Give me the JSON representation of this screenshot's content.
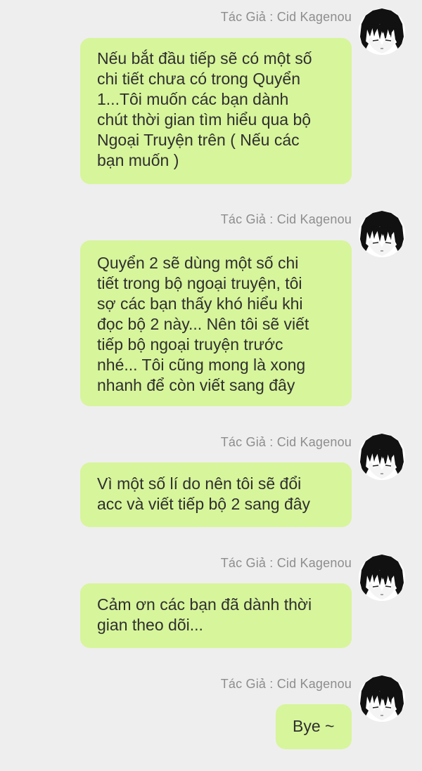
{
  "messages": [
    {
      "author": "Tác Giả : Cid Kagenou",
      "avatar_icon": "anime-character-avatar-icon",
      "text": "Nếu bắt đầu tiếp sẽ có một số\nchi tiết chưa có trong Quyển\n1...Tôi muốn các bạn dành\nchút thời gian tìm hiểu qua bộ\nNgoại Truyện trên ( Nếu các\nbạn muốn )"
    },
    {
      "author": "Tác Giả : Cid Kagenou",
      "avatar_icon": "anime-character-avatar-icon",
      "text": "Quyển 2 sẽ dùng một số chi\ntiết trong bộ ngoại truyện, tôi\nsợ các bạn thấy khó hiểu khi\nđọc bộ 2 này... Nên tôi sẽ viết\ntiếp bộ ngoại truyện trước\nnhé... Tôi cũng mong là xong\nnhanh để còn viết sang đây"
    },
    {
      "author": "Tác Giả : Cid Kagenou",
      "avatar_icon": "anime-character-avatar-icon",
      "text": "Vì một số lí do nên tôi sẽ đổi\nacc và viết tiếp bộ 2 sang đây"
    },
    {
      "author": "Tác Giả : Cid Kagenou",
      "avatar_icon": "anime-character-avatar-icon",
      "text": "Cảm ơn các bạn đã dành thời\ngian theo dõi..."
    },
    {
      "author": "Tác Giả : Cid Kagenou",
      "avatar_icon": "anime-character-avatar-icon",
      "text": "Bye ~"
    }
  ],
  "colors": {
    "background": "#eeeeee",
    "bubble": "#d7f59b",
    "author_text": "#8d8d8d",
    "message_text": "#2f2f2f"
  }
}
